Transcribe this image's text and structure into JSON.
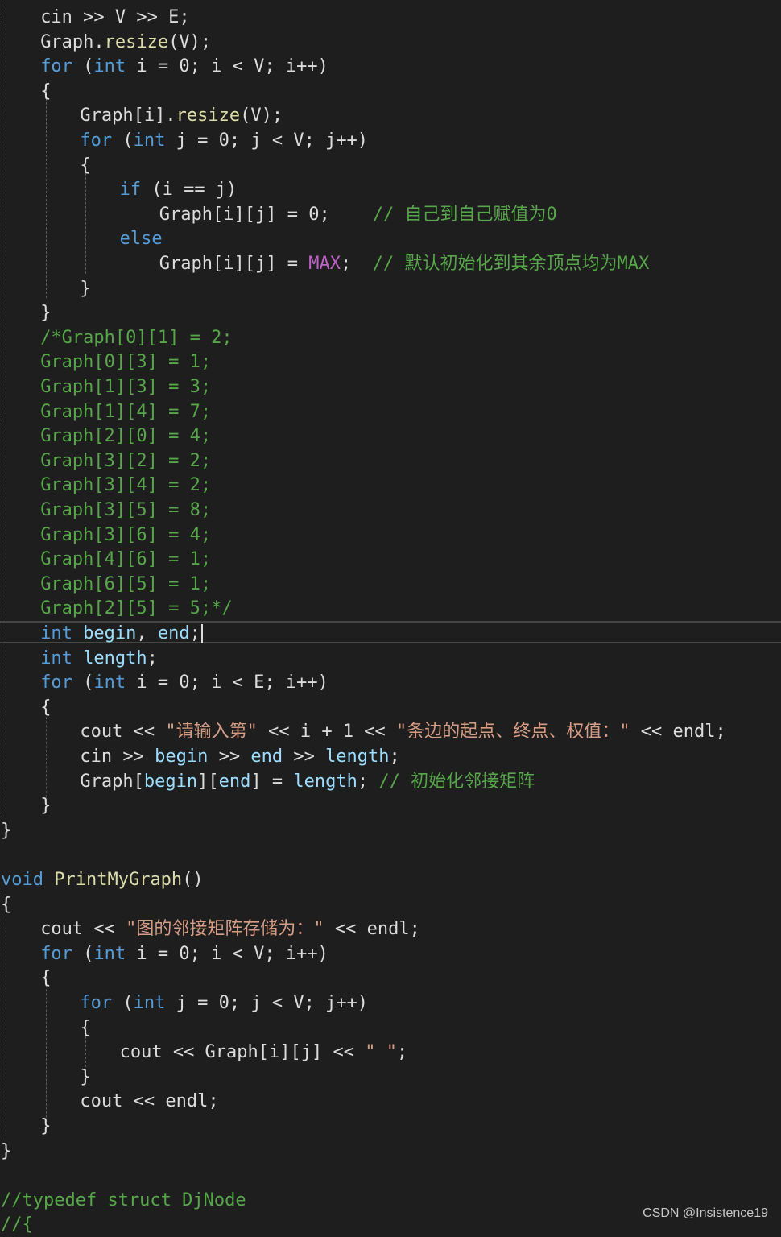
{
  "editor": {
    "lines": [
      {
        "indent": 2,
        "tokens": [
          {
            "t": "cin >> V >> E;",
            "c": "plain"
          }
        ]
      },
      {
        "indent": 2,
        "tokens": [
          {
            "t": "Graph.",
            "c": "plain"
          },
          {
            "t": "resize",
            "c": "func"
          },
          {
            "t": "(V);",
            "c": "plain"
          }
        ]
      },
      {
        "indent": 2,
        "tokens": [
          {
            "t": "for",
            "c": "keyword"
          },
          {
            "t": " (",
            "c": "plain"
          },
          {
            "t": "int",
            "c": "type"
          },
          {
            "t": " i = 0; i < V; i++)",
            "c": "plain"
          }
        ]
      },
      {
        "indent": 2,
        "tokens": [
          {
            "t": "{",
            "c": "plain"
          }
        ]
      },
      {
        "indent": 4,
        "tokens": [
          {
            "t": "Graph[i].",
            "c": "plain"
          },
          {
            "t": "resize",
            "c": "func"
          },
          {
            "t": "(V);",
            "c": "plain"
          }
        ]
      },
      {
        "indent": 4,
        "tokens": [
          {
            "t": "for",
            "c": "keyword"
          },
          {
            "t": " (",
            "c": "plain"
          },
          {
            "t": "int",
            "c": "type"
          },
          {
            "t": " j = 0; j < V; j++)",
            "c": "plain"
          }
        ]
      },
      {
        "indent": 4,
        "tokens": [
          {
            "t": "{",
            "c": "plain"
          }
        ]
      },
      {
        "indent": 6,
        "tokens": [
          {
            "t": "if",
            "c": "keyword"
          },
          {
            "t": " (i == j)",
            "c": "plain"
          }
        ]
      },
      {
        "indent": 8,
        "tokens": [
          {
            "t": "Graph[i][j] = 0;    ",
            "c": "plain"
          },
          {
            "t": "// 自己到自己赋值为0",
            "c": "comment"
          }
        ]
      },
      {
        "indent": 6,
        "tokens": [
          {
            "t": "else",
            "c": "keyword"
          }
        ]
      },
      {
        "indent": 8,
        "tokens": [
          {
            "t": "Graph[i][j] = ",
            "c": "plain"
          },
          {
            "t": "MAX",
            "c": "macro"
          },
          {
            "t": ";  ",
            "c": "plain"
          },
          {
            "t": "// 默认初始化到其余顶点均为MAX",
            "c": "comment"
          }
        ]
      },
      {
        "indent": 4,
        "tokens": [
          {
            "t": "}",
            "c": "plain"
          }
        ]
      },
      {
        "indent": 2,
        "tokens": [
          {
            "t": "}",
            "c": "plain"
          }
        ]
      },
      {
        "indent": 2,
        "tokens": [
          {
            "t": "/*Graph[0][1] = 2;",
            "c": "comment"
          }
        ]
      },
      {
        "indent": 2,
        "tokens": [
          {
            "t": "Graph[0][3] = 1;",
            "c": "comment"
          }
        ]
      },
      {
        "indent": 2,
        "tokens": [
          {
            "t": "Graph[1][3] = 3;",
            "c": "comment"
          }
        ]
      },
      {
        "indent": 2,
        "tokens": [
          {
            "t": "Graph[1][4] = 7;",
            "c": "comment"
          }
        ]
      },
      {
        "indent": 2,
        "tokens": [
          {
            "t": "Graph[2][0] = 4;",
            "c": "comment"
          }
        ]
      },
      {
        "indent": 2,
        "tokens": [
          {
            "t": "Graph[3][2] = 2;",
            "c": "comment"
          }
        ]
      },
      {
        "indent": 2,
        "tokens": [
          {
            "t": "Graph[3][4] = 2;",
            "c": "comment"
          }
        ]
      },
      {
        "indent": 2,
        "tokens": [
          {
            "t": "Graph[3][5] = 8;",
            "c": "comment"
          }
        ]
      },
      {
        "indent": 2,
        "tokens": [
          {
            "t": "Graph[3][6] = 4;",
            "c": "comment"
          }
        ]
      },
      {
        "indent": 2,
        "tokens": [
          {
            "t": "Graph[4][6] = 1;",
            "c": "comment"
          }
        ]
      },
      {
        "indent": 2,
        "tokens": [
          {
            "t": "Graph[6][5] = 1;",
            "c": "comment"
          }
        ]
      },
      {
        "indent": 2,
        "tokens": [
          {
            "t": "Graph[2][5] = 5;*/",
            "c": "comment"
          }
        ]
      },
      {
        "indent": 2,
        "current": true,
        "tokens": [
          {
            "t": "int",
            "c": "type"
          },
          {
            "t": " ",
            "c": "plain"
          },
          {
            "t": "begin",
            "c": "local"
          },
          {
            "t": ", ",
            "c": "plain"
          },
          {
            "t": "end",
            "c": "local"
          },
          {
            "t": ";",
            "c": "plain"
          }
        ]
      },
      {
        "indent": 2,
        "tokens": [
          {
            "t": "int",
            "c": "type"
          },
          {
            "t": " ",
            "c": "plain"
          },
          {
            "t": "length",
            "c": "local"
          },
          {
            "t": ";",
            "c": "plain"
          }
        ]
      },
      {
        "indent": 2,
        "tokens": [
          {
            "t": "for",
            "c": "keyword"
          },
          {
            "t": " (",
            "c": "plain"
          },
          {
            "t": "int",
            "c": "type"
          },
          {
            "t": " i = 0; i < E; i++)",
            "c": "plain"
          }
        ]
      },
      {
        "indent": 2,
        "tokens": [
          {
            "t": "{",
            "c": "plain"
          }
        ]
      },
      {
        "indent": 4,
        "tokens": [
          {
            "t": "cout << ",
            "c": "plain"
          },
          {
            "t": "\"请输入第\"",
            "c": "string"
          },
          {
            "t": " << i + 1 << ",
            "c": "plain"
          },
          {
            "t": "\"条边的起点、终点、权值：\"",
            "c": "string"
          },
          {
            "t": " << endl;",
            "c": "plain"
          }
        ]
      },
      {
        "indent": 4,
        "tokens": [
          {
            "t": "cin >> ",
            "c": "plain"
          },
          {
            "t": "begin",
            "c": "local"
          },
          {
            "t": " >> ",
            "c": "plain"
          },
          {
            "t": "end",
            "c": "local"
          },
          {
            "t": " >> ",
            "c": "plain"
          },
          {
            "t": "length",
            "c": "local"
          },
          {
            "t": ";",
            "c": "plain"
          }
        ]
      },
      {
        "indent": 4,
        "tokens": [
          {
            "t": "Graph[",
            "c": "plain"
          },
          {
            "t": "begin",
            "c": "local"
          },
          {
            "t": "][",
            "c": "plain"
          },
          {
            "t": "end",
            "c": "local"
          },
          {
            "t": "] = ",
            "c": "plain"
          },
          {
            "t": "length",
            "c": "local"
          },
          {
            "t": "; ",
            "c": "plain"
          },
          {
            "t": "// 初始化邻接矩阵",
            "c": "comment"
          }
        ]
      },
      {
        "indent": 2,
        "tokens": [
          {
            "t": "}",
            "c": "plain"
          }
        ]
      },
      {
        "indent": 0,
        "tokens": [
          {
            "t": "}",
            "c": "plain"
          }
        ]
      },
      {
        "indent": 0,
        "tokens": []
      },
      {
        "indent": 0,
        "tokens": [
          {
            "t": "void",
            "c": "keyword"
          },
          {
            "t": " ",
            "c": "plain"
          },
          {
            "t": "PrintMyGraph",
            "c": "func"
          },
          {
            "t": "()",
            "c": "plain"
          }
        ]
      },
      {
        "indent": 0,
        "tokens": [
          {
            "t": "{",
            "c": "plain"
          }
        ]
      },
      {
        "indent": 2,
        "tokens": [
          {
            "t": "cout << ",
            "c": "plain"
          },
          {
            "t": "\"图的邻接矩阵存储为：\"",
            "c": "string"
          },
          {
            "t": " << endl;",
            "c": "plain"
          }
        ]
      },
      {
        "indent": 2,
        "tokens": [
          {
            "t": "for",
            "c": "keyword"
          },
          {
            "t": " (",
            "c": "plain"
          },
          {
            "t": "int",
            "c": "type"
          },
          {
            "t": " i = 0; i < V; i++)",
            "c": "plain"
          }
        ]
      },
      {
        "indent": 2,
        "tokens": [
          {
            "t": "{",
            "c": "plain"
          }
        ]
      },
      {
        "indent": 4,
        "tokens": [
          {
            "t": "for",
            "c": "keyword"
          },
          {
            "t": " (",
            "c": "plain"
          },
          {
            "t": "int",
            "c": "type"
          },
          {
            "t": " j = 0; j < V; j++)",
            "c": "plain"
          }
        ]
      },
      {
        "indent": 4,
        "tokens": [
          {
            "t": "{",
            "c": "plain"
          }
        ]
      },
      {
        "indent": 6,
        "tokens": [
          {
            "t": "cout << Graph[i][j] << ",
            "c": "plain"
          },
          {
            "t": "\" \"",
            "c": "string"
          },
          {
            "t": ";",
            "c": "plain"
          }
        ]
      },
      {
        "indent": 4,
        "tokens": [
          {
            "t": "}",
            "c": "plain"
          }
        ]
      },
      {
        "indent": 4,
        "tokens": [
          {
            "t": "cout << endl;",
            "c": "plain"
          }
        ]
      },
      {
        "indent": 2,
        "tokens": [
          {
            "t": "}",
            "c": "plain"
          }
        ]
      },
      {
        "indent": 0,
        "tokens": [
          {
            "t": "}",
            "c": "plain"
          }
        ]
      },
      {
        "indent": 0,
        "tokens": []
      },
      {
        "indent": 0,
        "tokens": [
          {
            "t": "//typedef struct DjNode",
            "c": "comment"
          }
        ]
      },
      {
        "indent": 0,
        "tokens": [
          {
            "t": "//{",
            "c": "comment"
          }
        ]
      }
    ]
  },
  "colors": {
    "background": "#1e1e1e",
    "plain": "#dcdcdc",
    "keyword": "#569cd6",
    "type": "#569cd6",
    "func": "#dcdcaa",
    "comment": "#57a64a",
    "string": "#d69d85",
    "macro": "#bd63c5",
    "local": "#9cdcfe"
  },
  "watermark": "CSDN @Insistence19"
}
